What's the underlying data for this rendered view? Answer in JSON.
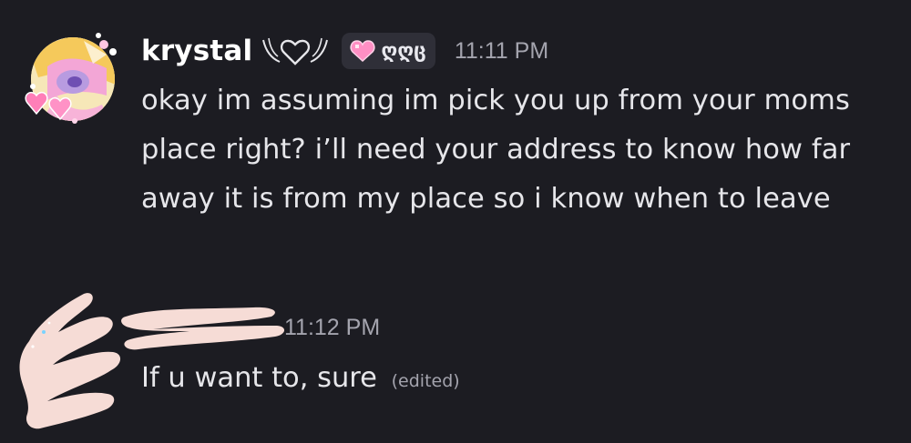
{
  "messages": [
    {
      "username": "krystal",
      "tag": {
        "icon": "pink-pixel-heart-icon",
        "text": "ღღც"
      },
      "timestamp": "11:11 PM",
      "text": "okay im assuming im pick you up from your moms place right? i’ll need your address to know how far away it is from my place so i know when to leave",
      "avatar_icon": "anime-avatar-with-hearts"
    },
    {
      "username_redacted": true,
      "timestamp": "11:12 PM",
      "text": "If u want to, sure",
      "edited_label": "(edited)"
    }
  ],
  "colors": {
    "background": "#1c1c22",
    "username": "#ffffff",
    "message_text": "#e6e6ea",
    "timestamp": "#a4a4ae",
    "tag_background": "#2f2f38",
    "redaction": "#f6dcd6"
  }
}
